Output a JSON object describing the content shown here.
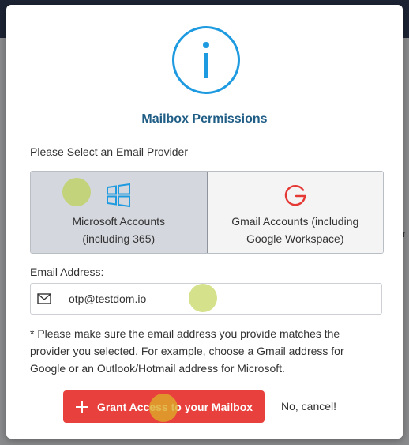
{
  "dialog": {
    "title": "Mailbox Permissions",
    "provider_prompt": "Please Select an Email Provider",
    "providers": [
      {
        "line1": "Microsoft Accounts",
        "line2": "(including 365)",
        "icon": "windows-icon",
        "selected": true
      },
      {
        "line1": "Gmail Accounts (including",
        "line2": "Google Workspace)",
        "icon": "google-icon",
        "selected": false
      }
    ],
    "email_label": "Email Address:",
    "email_value": "otp@testdom.io",
    "note": "* Please make sure the email address you provide matches the provider you selected. For example, choose a Gmail address for Google or an Outlook/Hotmail address for Microsoft.",
    "grant_button": "Grant Access to your Mailbox",
    "cancel_link": "No, cancel!"
  },
  "colors": {
    "title": "#205e86",
    "accent_red": "#e8403d",
    "windows_blue": "#1e9be0",
    "google_red": "#e53935",
    "selected_bg": "#d4d7dd"
  }
}
